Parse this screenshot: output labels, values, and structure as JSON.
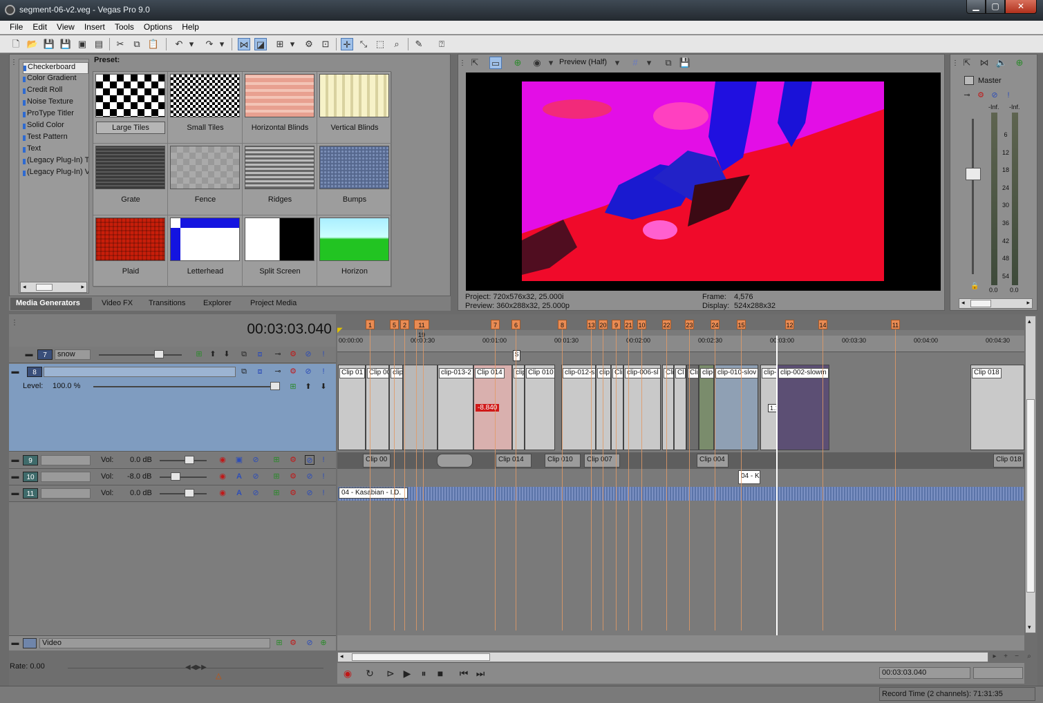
{
  "window": {
    "title": "segment-06-v2.veg - Vegas Pro 9.0",
    "min": "▁",
    "max": "▢",
    "close": "✕"
  },
  "menu": [
    "File",
    "Edit",
    "View",
    "Insert",
    "Tools",
    "Options",
    "Help"
  ],
  "media_generators": {
    "items": [
      "Checkerboard",
      "Color Gradient",
      "Credit Roll",
      "Noise Texture",
      "ProType Titler",
      "Solid Color",
      "Test Pattern",
      "Text",
      "(Legacy Plug-In) T",
      "(Legacy Plug-In) V"
    ],
    "selected": "Checkerboard",
    "preset_label": "Preset:",
    "presets": [
      "Large Tiles",
      "Small Tiles",
      "Horizontal Blinds",
      "Vertical Blinds",
      "Grate",
      "Fence",
      "Ridges",
      "Bumps",
      "Plaid",
      "Letterhead",
      "Split Screen",
      "Horizon"
    ],
    "selected_preset": "Large Tiles"
  },
  "window_tabs": [
    "Media Generators",
    "Video FX",
    "Transitions",
    "Explorer",
    "Project Media"
  ],
  "active_tab": "Media Generators",
  "preview": {
    "mode": "Preview (Half)",
    "project": "Project:  720x576x32, 25.000i",
    "preview": "Preview:  360x288x32, 25.000p",
    "frame_label": "Frame:",
    "frame_value": "4,576",
    "display_label": "Display:",
    "display_value": "524x288x32"
  },
  "master": {
    "label": "Master",
    "inf_left": "-Inf.",
    "inf_right": "-Inf.",
    "scale": [
      "6",
      "12",
      "18",
      "24",
      "30",
      "36",
      "42",
      "48",
      "54"
    ],
    "bottom_left": "0.0",
    "bottom_right": "0.0"
  },
  "timeline": {
    "timecode": "00:03:03.040",
    "ruler": [
      "00:00:00",
      "00:00:30",
      "00:01:00",
      "00:01:30",
      "00:02:00",
      "00:02:30",
      "00:03:00",
      "00:03:30",
      "00:04:00",
      "00:04:30"
    ],
    "markers": [
      "1",
      "3",
      "5",
      "2",
      "4",
      "11",
      "19",
      "7",
      "6",
      "8",
      "13",
      "20",
      "9",
      "21",
      "10",
      "22",
      "23",
      "24",
      "15",
      "12",
      "14",
      "11"
    ],
    "region_s": "S"
  },
  "tracks": {
    "t7": {
      "num": "7",
      "name": "snow"
    },
    "t8": {
      "num": "8",
      "name": "",
      "level_label": "Level:",
      "level_value": "100.0 %"
    },
    "t9": {
      "num": "9",
      "vol_label": "Vol:",
      "vol_value": "0.0 dB"
    },
    "t10": {
      "num": "10",
      "vol_label": "Vol:",
      "vol_value": "-8.0 dB"
    },
    "t11": {
      "num": "11",
      "vol_label": "Vol:",
      "vol_value": "0.0 dB"
    },
    "bus": {
      "name": "Video"
    },
    "rate": "Rate: 0.00"
  },
  "video_clips": [
    {
      "label": "Clip 01",
      "tc": "1:1:14:00"
    },
    {
      "label": "Clip 00",
      "tc": "1:1:02"
    },
    {
      "label": "clip",
      "tc": "0:00"
    },
    {
      "label": "clip-013-2",
      "tc": "46:15"
    },
    {
      "label": "Clip 014",
      "tc": "9:46:24",
      "gain": "-8.840"
    },
    {
      "label": "clip",
      "tc": "1:1"
    },
    {
      "label": "Clip 010",
      "tc": "26:55:12"
    },
    {
      "label": "clip-012-s",
      "tc": "17:06"
    },
    {
      "label": "clip",
      "tc": "4:16"
    },
    {
      "label": "Clip",
      "tc": "2:1"
    },
    {
      "label": "clip-006-sl",
      "tc": "2:22"
    },
    {
      "label": "Cli",
      "tc": ""
    },
    {
      "label": "Cl",
      "tc": "2:3"
    },
    {
      "label": "Cli",
      "tc": "1:1"
    },
    {
      "label": "clip-",
      "tc": ""
    },
    {
      "label": "clip-010-slov",
      "tc": "0:4"
    },
    {
      "label": "clip-",
      "tc": "9:16",
      "gain": "1.120"
    },
    {
      "label": "clip-002-slowm",
      "tc": "3:48"
    },
    {
      "label": "Clip 018",
      "tc": "17:52:20"
    }
  ],
  "audio_clips": {
    "t9": [
      "Clip 00",
      "Clip 014",
      "Clip 010",
      "Clip 007",
      "Clip 004",
      "Clip 018"
    ],
    "t10": [
      "04 - K"
    ],
    "t11": [
      "04 - Kasabian - I.D."
    ]
  },
  "transport": {
    "timecode": "00:03:03.040",
    "record_time": "Record Time (2 channels): 71:31:35"
  }
}
